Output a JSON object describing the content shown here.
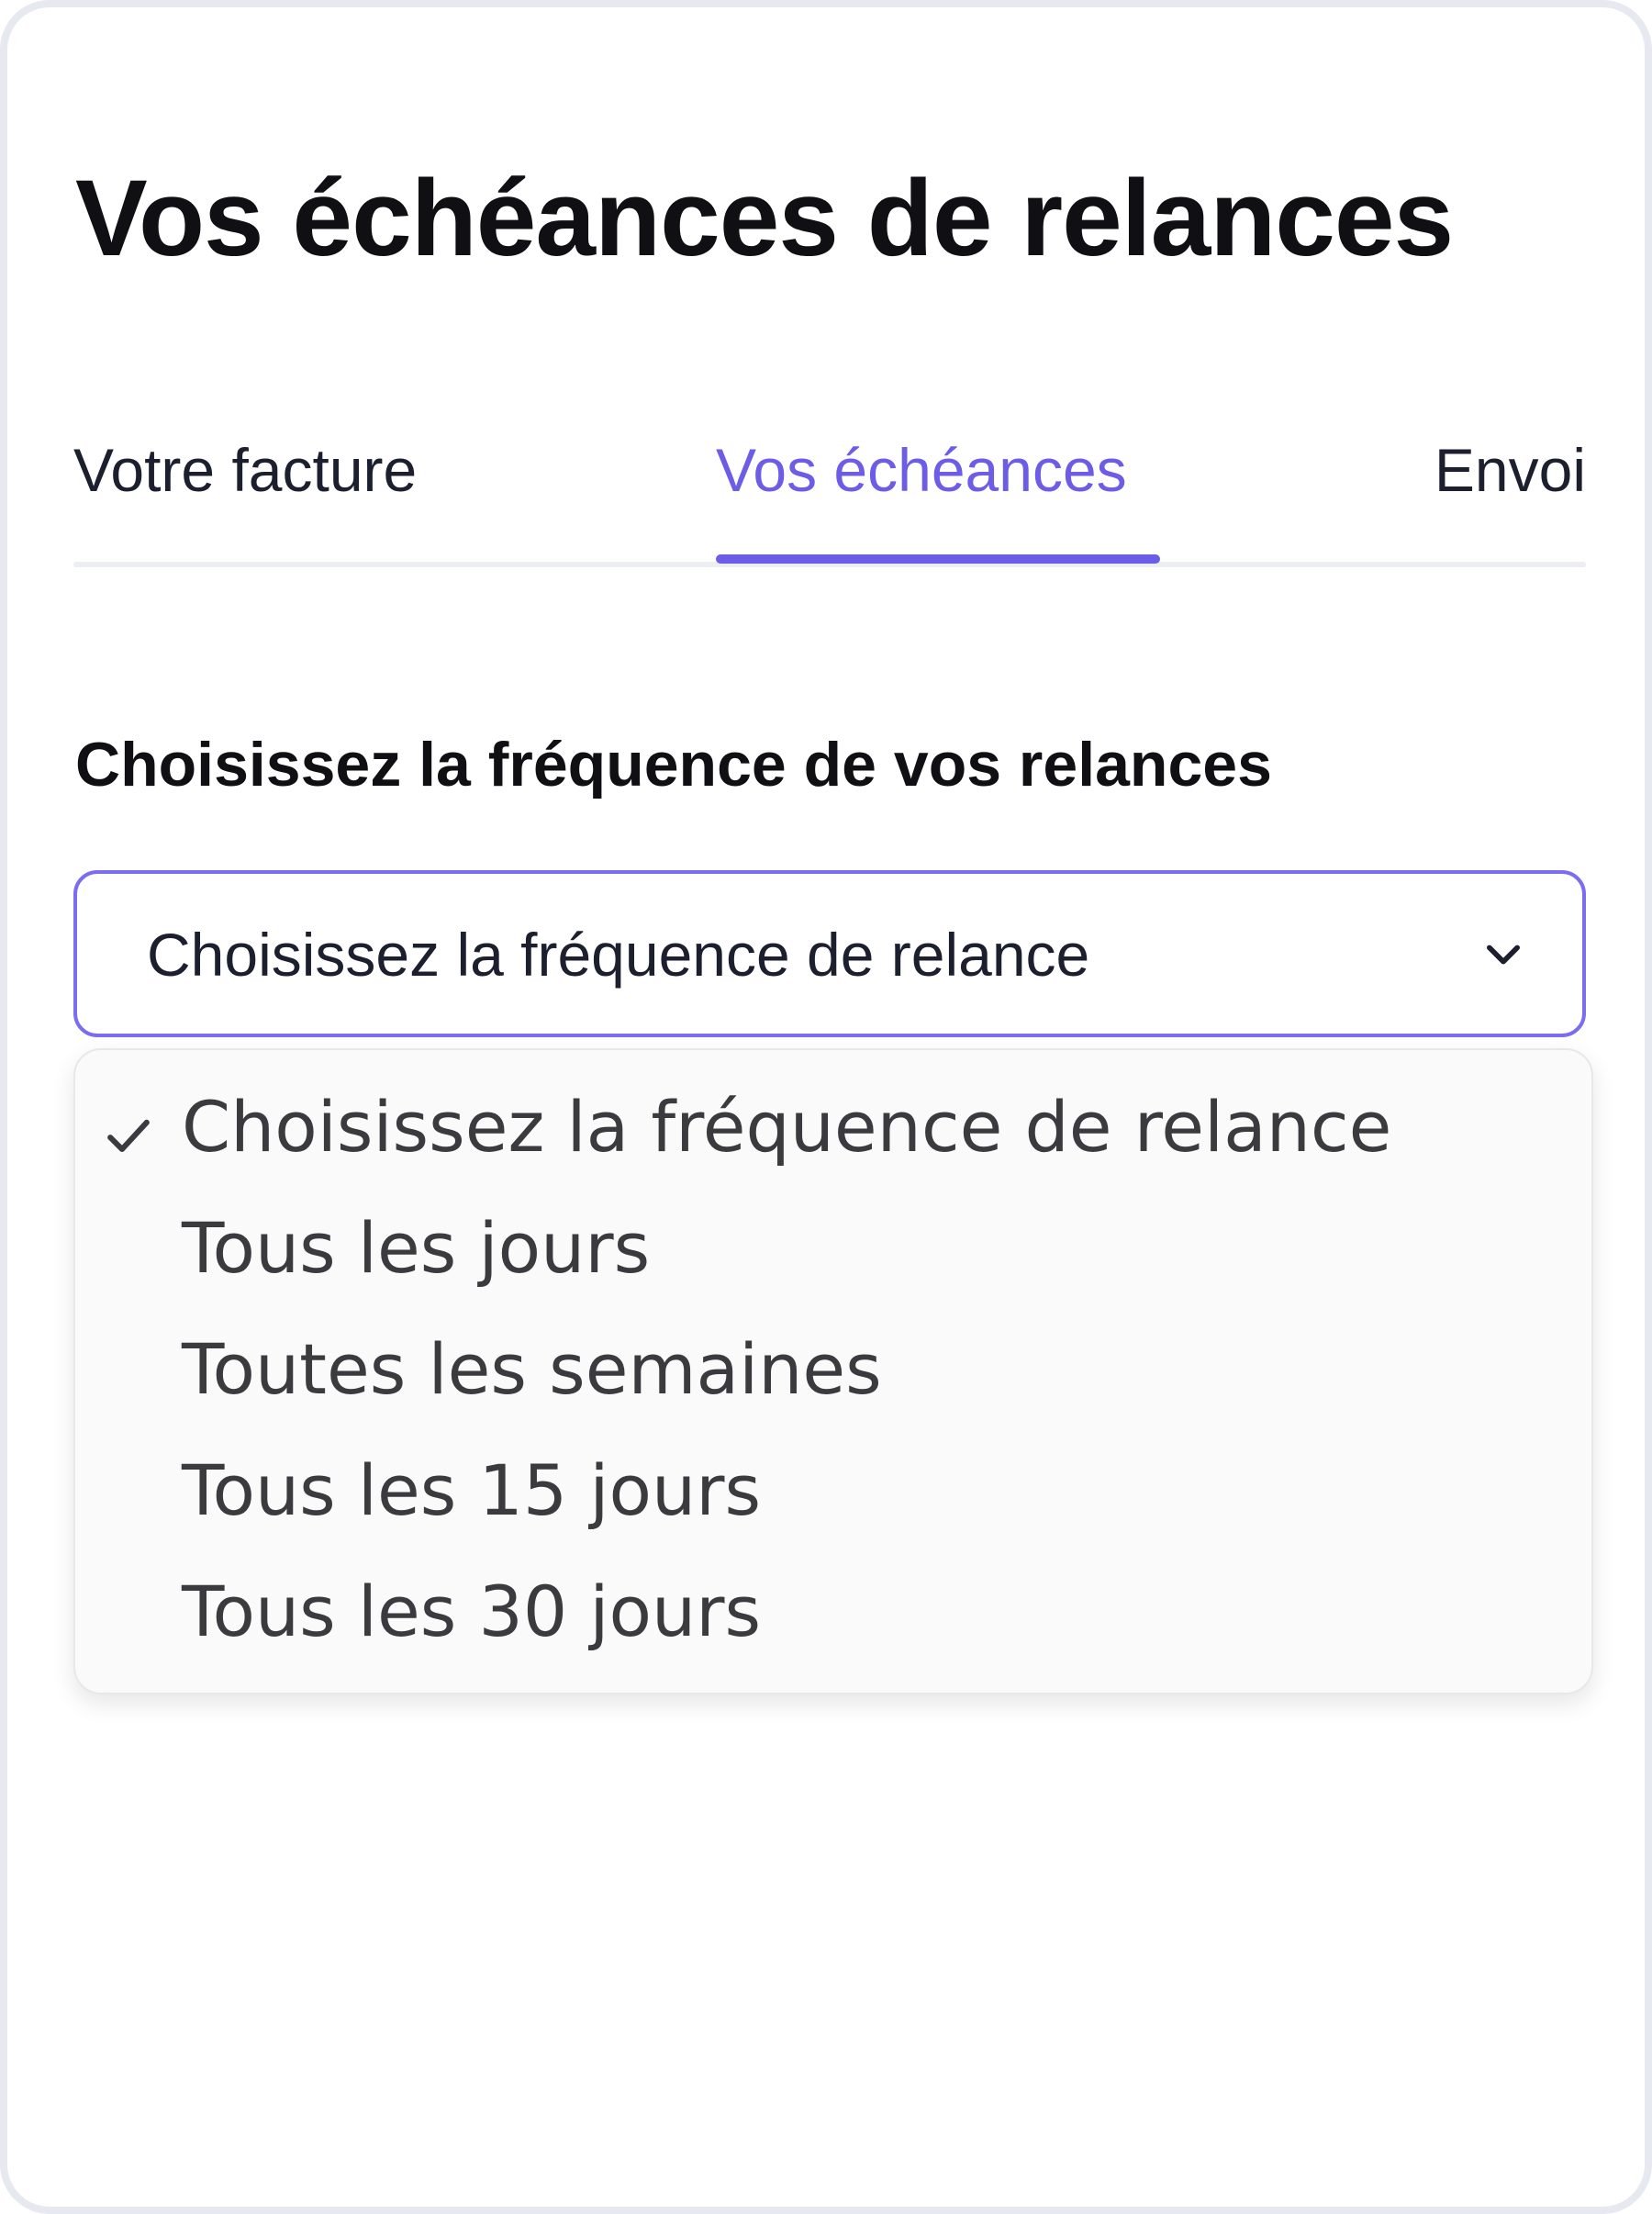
{
  "page": {
    "title": "Vos échéances de relances"
  },
  "tabs": [
    {
      "label": "Votre facture",
      "active": false
    },
    {
      "label": "Vos échéances",
      "active": true
    },
    {
      "label": "Envoi",
      "active": false
    }
  ],
  "frequency": {
    "section_label": "Choisissez la fréquence de vos relances",
    "select_value": "Choisissez la fréquence de relance",
    "options": [
      {
        "label": "Choisissez la fréquence de relance",
        "selected": true
      },
      {
        "label": "Tous les jours",
        "selected": false
      },
      {
        "label": "Toutes les semaines",
        "selected": false
      },
      {
        "label": "Tous les 15 jours",
        "selected": false
      },
      {
        "label": "Tous les 30 jours",
        "selected": false
      }
    ]
  },
  "icons": {
    "dropdown_indicator": "chevron-down-icon",
    "selected_indicator": "check-icon"
  },
  "colors": {
    "accent": "#6c5ce7",
    "text": "#0f0f14",
    "option_text": "#3b3b3f"
  }
}
